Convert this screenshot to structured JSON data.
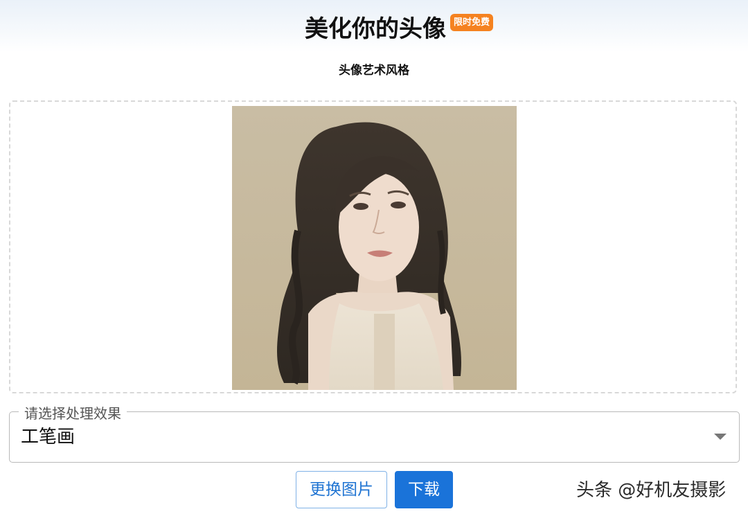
{
  "header": {
    "title": "美化你的头像",
    "badge": "限时免费"
  },
  "subtitle": "头像艺术风格",
  "preview": {
    "image_description_icon": "portrait-image"
  },
  "effect_select": {
    "label": "请选择处理效果",
    "value": "工笔画"
  },
  "actions": {
    "change_image_label": "更换图片",
    "download_label": "下载"
  },
  "watermark": "头条 @好机友摄影",
  "colors": {
    "badge": "#f58220",
    "primary": "#1a73d9",
    "portrait_bg": "#c7b89c"
  }
}
